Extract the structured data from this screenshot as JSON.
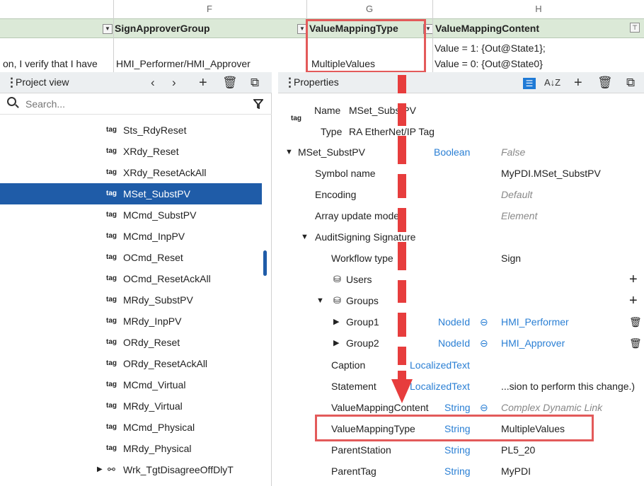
{
  "sheet": {
    "col_letters": [
      "F",
      "G",
      "H"
    ],
    "headers": {
      "sign_approver_group": "SignApproverGroup",
      "value_mapping_type": "ValueMappingType",
      "value_mapping_content": "ValueMappingContent"
    },
    "row": {
      "statement_tail": "on, I verify that I have",
      "approver_group": "HMI_Performer/HMI_Approver",
      "mapping_type": "MultipleValues",
      "mapping_content_1": "Value = 1: {Out@State1};",
      "mapping_content_2": "Value = 0: {Out@State0}"
    }
  },
  "project_view": {
    "title": "Project view",
    "search_placeholder": "Search...",
    "tag_icon_text": "tag",
    "items": [
      {
        "label": "Sts_RdyReset"
      },
      {
        "label": "XRdy_Reset"
      },
      {
        "label": "XRdy_ResetAckAll"
      },
      {
        "label": "MSet_SubstPV",
        "selected": true
      },
      {
        "label": "MCmd_SubstPV"
      },
      {
        "label": "MCmd_InpPV"
      },
      {
        "label": "OCmd_Reset"
      },
      {
        "label": "OCmd_ResetAckAll"
      },
      {
        "label": "MRdy_SubstPV"
      },
      {
        "label": "MRdy_InpPV"
      },
      {
        "label": "ORdy_Reset"
      },
      {
        "label": "ORdy_ResetAckAll"
      },
      {
        "label": "MCmd_Virtual"
      },
      {
        "label": "MRdy_Virtual"
      },
      {
        "label": "MCmd_Physical"
      },
      {
        "label": "MRdy_Physical"
      }
    ],
    "last_item": "Wrk_TgtDisagreeOffDlyT"
  },
  "properties": {
    "title": "Properties",
    "tag_icon_text": "tag",
    "name_label": "Name",
    "name_value": "MSet_SubstPV",
    "type_label": "Type",
    "type_value": "RA EtherNet/IP Tag",
    "rows": {
      "root": {
        "name": "MSet_SubstPV",
        "type": "Boolean",
        "value": "False"
      },
      "symbol": {
        "name": "Symbol name",
        "value": "MyPDI.MSet_SubstPV"
      },
      "encoding": {
        "name": "Encoding",
        "value": "Default"
      },
      "array_update": {
        "name": "Array update mode",
        "value": "Element"
      },
      "audit": {
        "name": "AuditSigning Signature"
      },
      "workflow": {
        "name": "Workflow type",
        "value": "Sign"
      },
      "users": {
        "name": "Users"
      },
      "groups": {
        "name": "Groups"
      },
      "group1": {
        "name": "Group1",
        "type": "NodeId",
        "value": "HMI_Performer"
      },
      "group2": {
        "name": "Group2",
        "type": "NodeId",
        "value": "HMI_Approver"
      },
      "caption": {
        "name": "Caption",
        "type": "LocalizedText"
      },
      "statement": {
        "name": "Statement",
        "type": "LocalizedText",
        "value": "...sion to perform this change.)"
      },
      "vm_content": {
        "name": "ValueMappingContent",
        "type": "String",
        "value": "Complex Dynamic Link"
      },
      "vm_type": {
        "name": "ValueMappingType",
        "type": "String",
        "value": "MultipleValues"
      },
      "parent_station": {
        "name": "ParentStation",
        "type": "String",
        "value": "PL5_20"
      },
      "parent_tag": {
        "name": "ParentTag",
        "type": "String",
        "value": "MyPDI"
      }
    }
  },
  "colors": {
    "selection": "#1f5ca8",
    "highlight_red": "#e35a5a",
    "type_blue": "#2a7fd4",
    "sheet_header_green": "#dbe9d7"
  }
}
